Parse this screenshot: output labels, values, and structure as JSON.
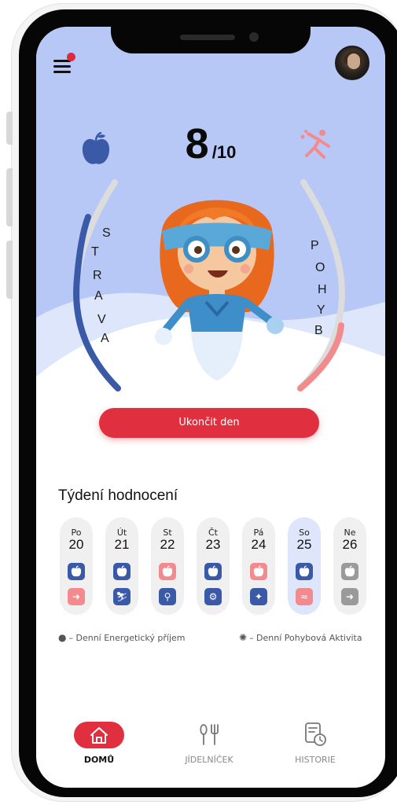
{
  "header": {
    "menu_icon": "hamburger-menu-icon",
    "notification_badge_color": "#e2283f",
    "avatar": "user-avatar"
  },
  "score": {
    "value": "8",
    "max": "/10"
  },
  "gauges": {
    "left_label": "STRAVA",
    "right_label": "POHYB",
    "left_color": "#3a5aa8",
    "right_color": "#f28a8e",
    "left_icon": "apple-icon",
    "right_icon": "sport-icon"
  },
  "end_day_button": "Ukončit den",
  "week": {
    "title": "Týdení hodnocení",
    "days": [
      {
        "name": "Po",
        "num": "20",
        "food": "blue",
        "move": "pink",
        "move_icon": "running-icon"
      },
      {
        "name": "Út",
        "num": "21",
        "food": "blue",
        "move": "blue",
        "move_icon": "skiing-icon"
      },
      {
        "name": "St",
        "num": "22",
        "food": "pink",
        "move": "blue",
        "move_icon": "walking-icon"
      },
      {
        "name": "Čt",
        "num": "23",
        "food": "blue",
        "move": "blue",
        "move_icon": "cycling-icon"
      },
      {
        "name": "Pá",
        "num": "24",
        "food": "pink",
        "move": "blue",
        "move_icon": "exercise-icon"
      },
      {
        "name": "So",
        "num": "25",
        "food": "blue",
        "move": "pink",
        "move_icon": "swimming-icon",
        "active": true
      },
      {
        "name": "Ne",
        "num": "26",
        "food": "gray",
        "move": "gray",
        "move_icon": "running-icon"
      }
    ]
  },
  "legend": {
    "food": "– Denní Energetický příjem",
    "activity": "– Denní Pohybová Aktivita"
  },
  "tabbar": {
    "home": "DOMŮ",
    "menu": "JÍDELNÍČEK",
    "history": "HISTORIE"
  },
  "colors": {
    "accent_red": "#e0303f",
    "hero_blue": "#b7c8f6",
    "status_blue": "#3a5aa8",
    "status_pink": "#f28a8e",
    "status_gray": "#9a9a9a",
    "active_day_bg": "#dde6fb"
  }
}
